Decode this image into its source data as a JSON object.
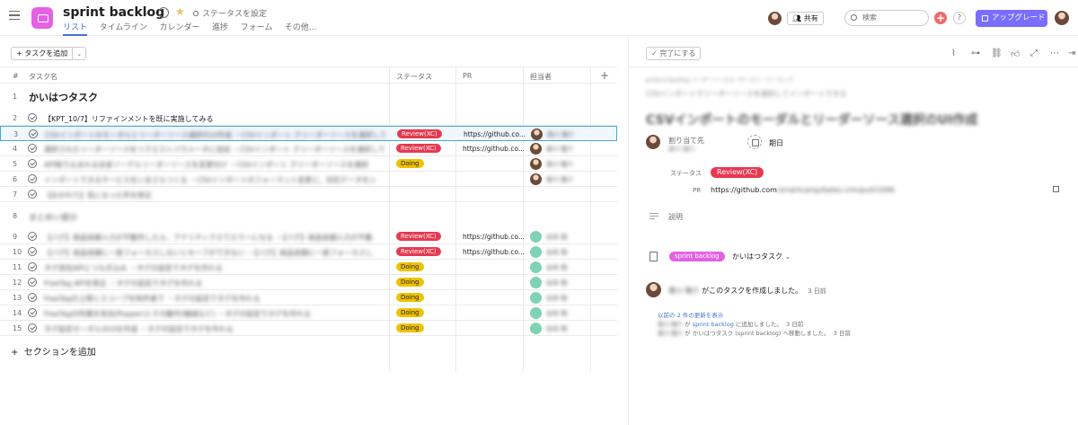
{
  "header": {
    "project_title": "sprint backlog",
    "status_label": "ステータスを設定",
    "tabs": [
      {
        "label": "リスト",
        "active": true
      },
      {
        "label": "タイムライン"
      },
      {
        "label": "カレンダー"
      },
      {
        "label": "進捗"
      },
      {
        "label": "フォーム"
      },
      {
        "label": "その他..."
      }
    ],
    "share_label": "共有",
    "search_placeholder": "検索",
    "help_label": "?",
    "upgrade_label": "アップグレード",
    "colors": {
      "project": "#e362e3",
      "accent": "#4573d2",
      "upgrade": "#796eff",
      "add": "#f06a6a"
    }
  },
  "list": {
    "add_task_label": "タスクを追加",
    "columns": {
      "num": "#",
      "task": "タスク名",
      "status": "ステータス",
      "pr": "PR",
      "assignee": "担当者",
      "add": "+"
    },
    "sections": [
      {
        "num": "1",
        "title": "かいはつタスク"
      },
      {
        "num": "8",
        "title": "まとめい部分"
      }
    ],
    "rows": [
      {
        "num": "2",
        "name": "【KPT_10/7】リファインメントを既に実施してみる",
        "blur": false,
        "status": "",
        "pr": "",
        "assignee": ""
      },
      {
        "num": "3",
        "name": "CSVインポートのモーダルとリーダーソース選択のUI作成 ・CSVインポート クリーダーソースを選択してください",
        "blur": true,
        "status": "Review(XC)",
        "pr": "https://github.co...",
        "assignee": "香川 隆介",
        "selected": true
      },
      {
        "num": "4",
        "name": "選択されたリーダーソースをリクエストパラメータに追加 ・CSVインポート クリーダーソースを選択してください",
        "blur": true,
        "status": "Review(XC)",
        "pr": "https://github.co...",
        "assignee": "香川 隆介"
      },
      {
        "num": "5",
        "name": "API取り込まれる全金ソーデルリーダーソースを変更付け ・CSVインポート クリーダーソースを選択",
        "blur": true,
        "status": "Doing",
        "pr": "",
        "assignee": "香川 隆介"
      },
      {
        "num": "6",
        "name": "インポートできるサービスをいまさらつくる ・CSVインポートのフォーマット変更と、対応データをシ",
        "blur": true,
        "status": "",
        "pr": "",
        "assignee": "香川 隆介"
      },
      {
        "num": "7",
        "name": "【おかわり】気になった件を修正",
        "blur": true,
        "status": "",
        "pr": "",
        "assignee": ""
      },
      {
        "num": "9",
        "name": "【バグ】商品金額入力が不動作したら、アナリティクスでエラーになる ・【バグ】商品金額入力が不動",
        "blur": true,
        "status": "Review(XC)",
        "pr": "https://github.co...",
        "assignee": "谷本 翔"
      },
      {
        "num": "10",
        "name": "【バグ】商品金額に一度フォーカスしないとセーブができない ・【バグ】商品金額に一度フォーカスし",
        "blur": true,
        "status": "Review(XC)",
        "pr": "https://github.co...",
        "assignee": "谷本 翔"
      },
      {
        "num": "11",
        "name": "タグ自在APIとつなぎ込み ・タグの設定でタグを作れる",
        "blur": true,
        "status": "Doing",
        "pr": "",
        "assignee": "谷本 翔"
      },
      {
        "num": "12",
        "name": "FreeTag APIを修正 ・タグの設定でタグを作れる",
        "blur": true,
        "status": "Doing",
        "pr": "",
        "assignee": "谷本 翔"
      },
      {
        "num": "13",
        "name": "FreeTagの上限とスコープを制作者で ・タグの設定でタグを作れる",
        "blur": true,
        "status": "Doing",
        "pr": "",
        "assignee": "谷本 翔"
      },
      {
        "num": "14",
        "name": "FreeTagの所属を有効(Popper)とその動作(機械など) ・タグの設定でタグを作れる",
        "blur": true,
        "status": "Doing",
        "pr": "",
        "assignee": "谷本 翔"
      },
      {
        "num": "15",
        "name": "タグ設定モーダルのUIを作成 ・タグの設定でタグを作れる",
        "blur": true,
        "status": "Doing",
        "pr": "",
        "assignee": "谷本 翔"
      }
    ],
    "add_section_label": "セクションを追加"
  },
  "detail": {
    "complete_label": "完了にする",
    "breadcrumb": "product backlog  リーダーソースユーザーストーリーマップ",
    "subtitle": "CSVインポートでリーダーソースを選択してインポートできる",
    "title": "CSVインポートのモーダルとリーダーソース選択のUI作成",
    "assignee_label": "割り当て先",
    "assignee_name": "香川 隆介",
    "due_label": "期日",
    "status_label": "ステータス",
    "status_value": "Review(XC)",
    "pr_label": "PR",
    "pr_url_start": "https://github.com",
    "pr_url_rest": "/smartcamp/bales-crm/pull/1096",
    "desc_label": "説明",
    "project_pill": "sprint backlog",
    "project_section": "かいはつタスク",
    "activity_user": "香川 隆介",
    "activity_text": "がこのタスクを作成しました。",
    "activity_time": "3 日前",
    "updates_link": "以前の 2 件の更新を表示",
    "updates": [
      {
        "user": "香川 隆介",
        "pre": "が",
        "link": "sprint backlog",
        "post": "に追加しました。",
        "time": "3 日前"
      },
      {
        "user": "香川 隆介",
        "pre": "が",
        "link": "",
        "post": "かいはつタスク (sprint backlog) へ移動しました。",
        "time": "3 日前"
      }
    ]
  }
}
